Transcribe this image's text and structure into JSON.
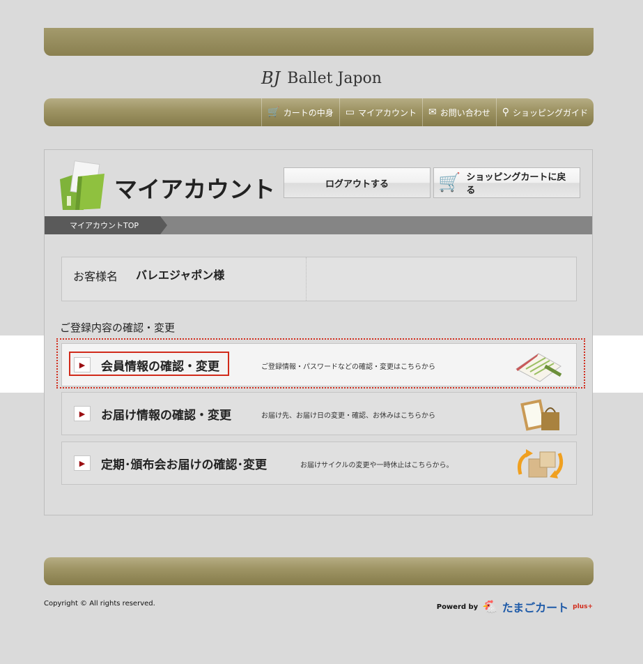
{
  "brand": {
    "mark": "BJ",
    "name": "Ballet Japon"
  },
  "nav": [
    {
      "icon": "🛒",
      "label": "カートの中身"
    },
    {
      "icon": "▭",
      "label": "マイアカウント"
    },
    {
      "icon": "✉",
      "label": "お問い合わせ"
    },
    {
      "icon": "⚲",
      "label": "ショッピングガイド"
    }
  ],
  "page": {
    "title": "マイアカウント",
    "logout_label": "ログアウトする",
    "cart_back_label": "ショッピングカートに戻る",
    "breadcrumb": "マイアカウントTOP"
  },
  "customer": {
    "label": "お客様名",
    "name": "バレエジャポン様"
  },
  "section_heading": "ご登録内容の確認・変更",
  "menu": [
    {
      "arrow": "▶",
      "title": "会員情報の確認・変更",
      "desc": "ご登録情報・パスワードなどの確認・変更はこちらから"
    },
    {
      "arrow": "▶",
      "title": "お届け情報の確認・変更",
      "desc": "お届け先、お届け日の変更・確認、お休みはこちらから"
    },
    {
      "arrow": "▶",
      "title": "定期･頒布会お届けの確認･変更",
      "desc": "お届けサイクルの変更や一時休止はこちらから。"
    }
  ],
  "footer": {
    "copyright": "Copyright © All rights reserved.",
    "powered_by": "Powerd by",
    "powered_name": "たまごカート",
    "powered_plus": "plus+"
  },
  "colors": {
    "gold": "#9f9565",
    "accent_red": "#d12a1a",
    "arrow_red": "#9b0f13"
  }
}
